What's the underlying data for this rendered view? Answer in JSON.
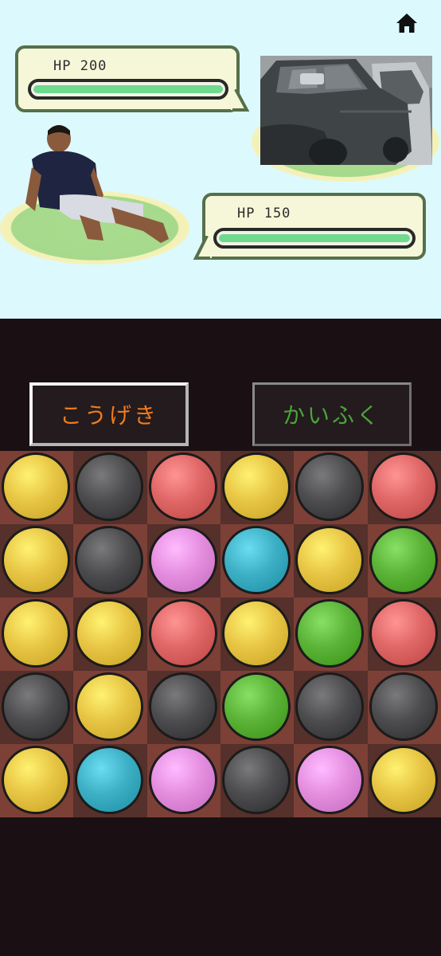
{
  "battle": {
    "home_icon": "home-icon",
    "enemy": {
      "hp_label": "HP 200",
      "hp_fraction": 1.0
    },
    "player": {
      "hp_label": "HP 150",
      "hp_fraction": 1.0
    }
  },
  "actions": {
    "attack_label": "こうげき",
    "attack_color": "#f07a1c",
    "heal_label": "かいふく",
    "heal_color": "#4aa43a"
  },
  "board": {
    "colors": {
      "yellow": "#e8c544",
      "black": "#4d4d4f",
      "red": "#df6766",
      "pink": "#e58ee0",
      "cyan": "#3eb0c6",
      "green": "#5bb338"
    },
    "tiles": [
      "#7c4037",
      "#56302a"
    ],
    "rows": [
      [
        "yellow",
        "black",
        "red",
        "yellow",
        "black",
        "red"
      ],
      [
        "yellow",
        "black",
        "pink",
        "cyan",
        "yellow",
        "green"
      ],
      [
        "yellow",
        "yellow",
        "red",
        "yellow",
        "green",
        "red"
      ],
      [
        "black",
        "yellow",
        "black",
        "green",
        "black",
        "black"
      ],
      [
        "yellow",
        "cyan",
        "pink",
        "black",
        "pink",
        "yellow"
      ]
    ]
  }
}
